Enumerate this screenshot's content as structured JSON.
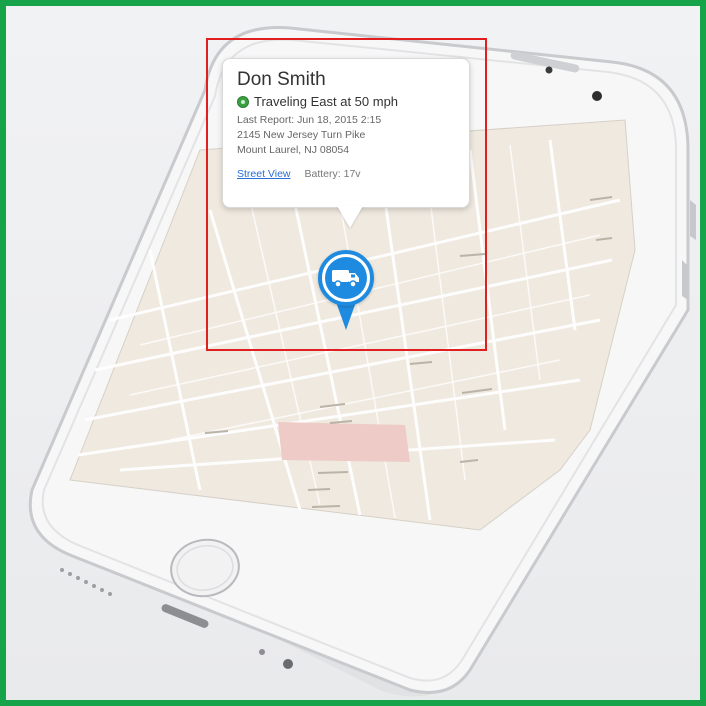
{
  "popup": {
    "driver_name": "Don Smith",
    "status": "Traveling East at 50 mph",
    "last_report": "Last Report: Jun 18, 2015 2:15",
    "address_line1": "2145 New Jersey Turn Pike",
    "address_line2": "Mount Laurel, NJ 08054",
    "street_view_label": "Street View",
    "battery": "Battery: 17v"
  },
  "colors": {
    "frame_border": "#16a34a",
    "highlight_box": "#e02020",
    "pin_blue": "#1f8be0",
    "status_green": "#3aa042",
    "map_background": "#efe9df",
    "map_block_highlight": "#eecbc6"
  },
  "icons": {
    "status": "green-dot-icon",
    "marker": "truck-icon",
    "home": "home-button-icon"
  }
}
